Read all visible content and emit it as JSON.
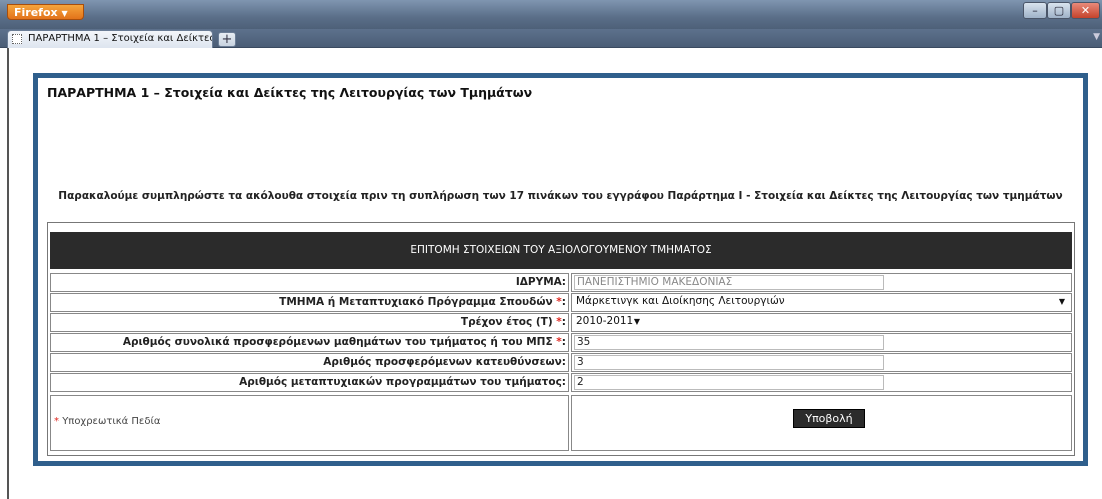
{
  "browser": {
    "app_button_label": "Firefox",
    "tab_title": "ΠΑΡΑΡΤΗΜΑ 1 – Στοιχεία και Δείκτες τ...",
    "new_tab_label": "+"
  },
  "page": {
    "title": "ΠΑΡΑΡΤΗΜΑ 1 – Στοιχεία και Δείκτες της Λειτουργίας των Τμημάτων",
    "intro": "Παρακαλούμε συμπληρώστε τα ακόλουθα στοιχεία πριν τη συπλήρωση των 17 πινάκων του εγγράφου Παράρτημα Ι - Στοιχεία και Δείκτες της Λειτουργίας των τμημάτων",
    "form_header": "ΕΠΙΤΟΜΗ ΣΤΟΙΧΕΙΩΝ ΤΟΥ ΑΞΙΟΛΟΓΟΥΜΕΝΟΥ ΤΜΗΜΑΤΟΣ",
    "rows": [
      {
        "label": "ΙΔΡΥΜΑ:",
        "required": false,
        "value": "ΠΑΝΕΠΙΣΤΗΜΙΟ ΜΑΚΕΔΟΝΙΑΣ"
      },
      {
        "label": "ΤΜΗΜΑ ή Μεταπτυχιακό Πρόγραμμα Σπουδών",
        "required": true,
        "value": "Μάρκετινγκ και Διοίκησης Λειτουργιών"
      },
      {
        "label": "Τρέχον έτος (Τ)",
        "required": true,
        "value": "2010-2011"
      },
      {
        "label": "Αριθμός συνολικά προσφερόμενων μαθημάτων του τμήματος ή του ΜΠΣ",
        "required": true,
        "value": "35"
      },
      {
        "label": "Αριθμός προσφερόμενων κατευθύνσεων:",
        "required": false,
        "value": "3"
      },
      {
        "label": "Αριθμός μεταπτυχιακών προγραμμάτων του τμήματος:",
        "required": false,
        "value": "2"
      }
    ],
    "required_marker": "*",
    "required_suffix": ":",
    "required_note": "Υποχρεωτικά Πεδία",
    "submit_label": "Υποβολή"
  }
}
